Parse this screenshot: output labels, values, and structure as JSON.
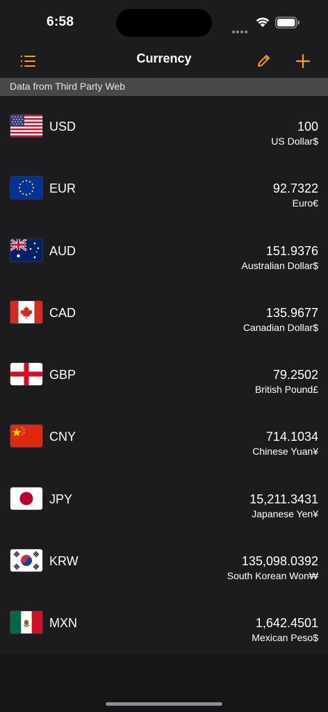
{
  "status": {
    "time": "6:58"
  },
  "nav": {
    "title": "Currency",
    "accent": "#ff9f0a"
  },
  "source": {
    "text": "Data from Third Party Web"
  },
  "currencies": [
    {
      "code": "USD",
      "value": "100",
      "name": "US Dollar$",
      "flag": "us-flag"
    },
    {
      "code": "EUR",
      "value": "92.7322",
      "name": "Euro€",
      "flag": "eu-flag"
    },
    {
      "code": "AUD",
      "value": "151.9376",
      "name": "Australian Dollar$",
      "flag": "au-flag"
    },
    {
      "code": "CAD",
      "value": "135.9677",
      "name": "Canadian Dollar$",
      "flag": "ca-flag"
    },
    {
      "code": "GBP",
      "value": "79.2502",
      "name": "British Pound£",
      "flag": "gb-flag"
    },
    {
      "code": "CNY",
      "value": "714.1034",
      "name": "Chinese Yuan¥",
      "flag": "cn-flag"
    },
    {
      "code": "JPY",
      "value": "15,211.3431",
      "name": "Japanese Yen¥",
      "flag": "jp-flag"
    },
    {
      "code": "KRW",
      "value": "135,098.0392",
      "name": "South Korean Won₩",
      "flag": "kr-flag"
    },
    {
      "code": "MXN",
      "value": "1,642.4501",
      "name": "Mexican Peso$",
      "flag": "mx-flag"
    }
  ]
}
